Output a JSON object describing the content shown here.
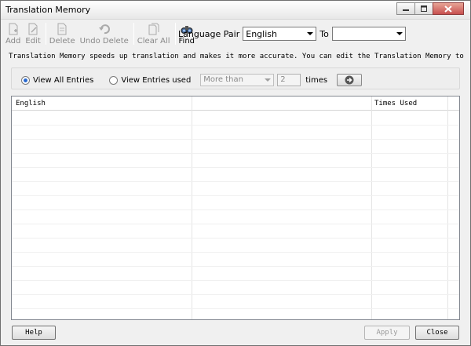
{
  "window": {
    "title": "Translation Memory"
  },
  "toolbar": {
    "add": "Add",
    "edit": "Edit",
    "delete": "Delete",
    "undo_delete": "Undo Delete",
    "clear_all": "Clear All",
    "find": "Find",
    "language_pair_label": "Language Pair",
    "source_language": "English",
    "to_label": "To",
    "target_language": ""
  },
  "info_text": "Translation Memory speeds up translation and makes it more accurate. You can edit the Translation Memory to improve th...",
  "filter": {
    "view_all_label": "View All Entries",
    "view_used_label": "View Entries used",
    "comparison": "More than",
    "count": "2",
    "times_label": "times",
    "selected": "view_all"
  },
  "table": {
    "columns": [
      "English",
      "",
      "Times Used"
    ],
    "rows": []
  },
  "footer": {
    "help": "Help",
    "apply": "Apply",
    "close": "Close"
  },
  "colors": {
    "radio_checked": "#2a6ad0",
    "close_button": "#c75050"
  }
}
